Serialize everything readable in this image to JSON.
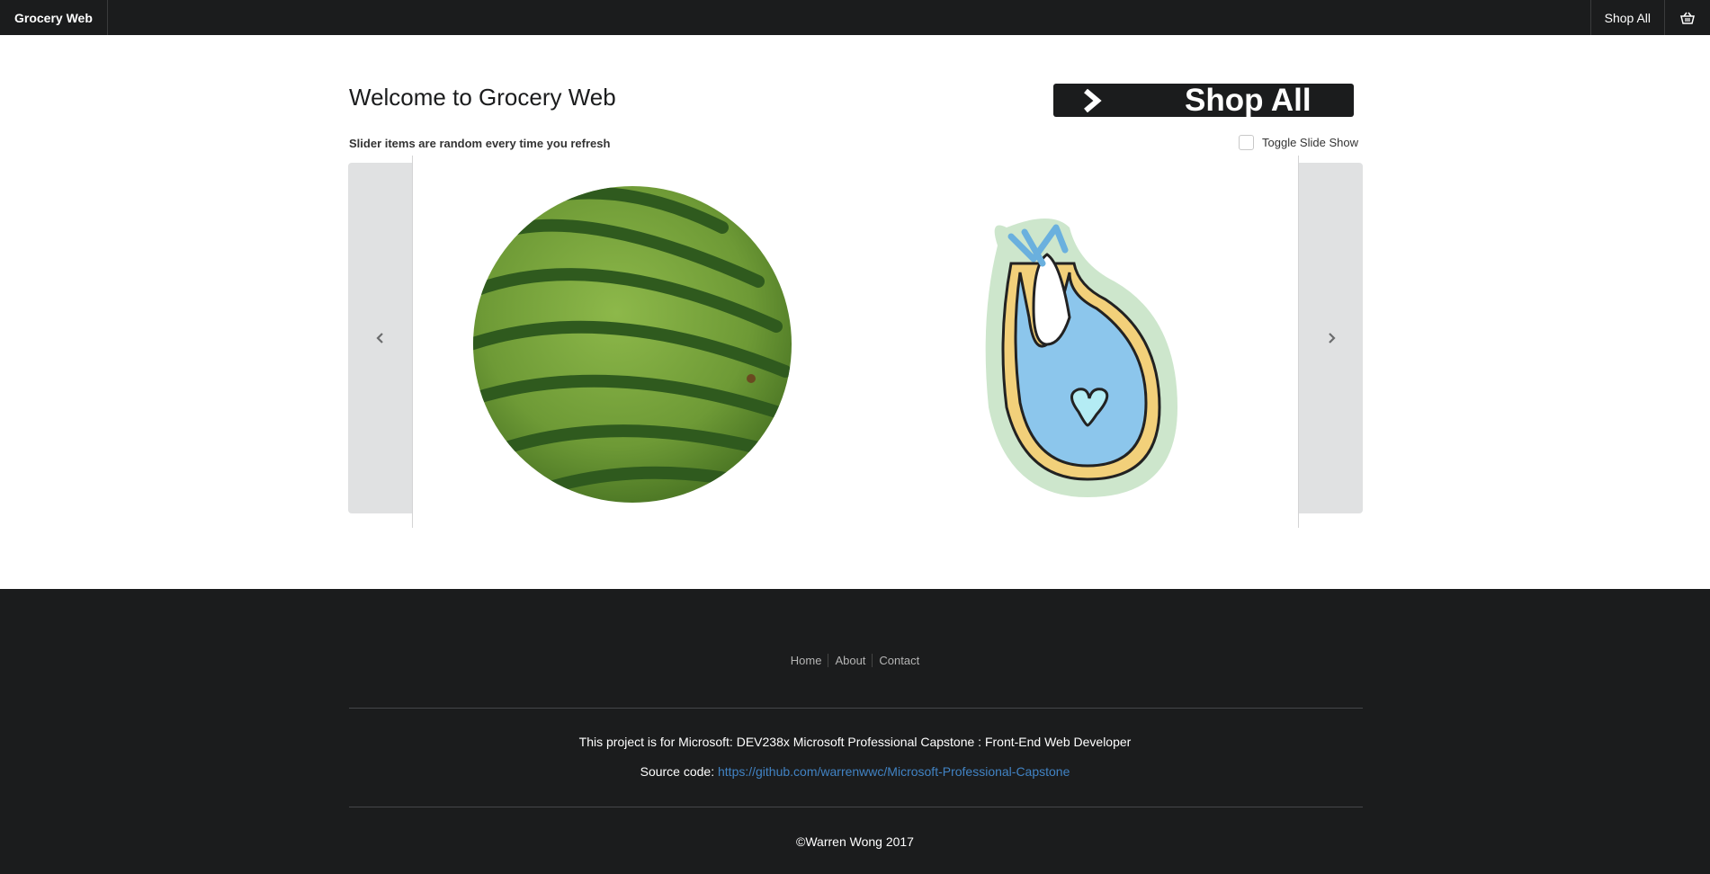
{
  "nav": {
    "brand": "Grocery Web",
    "shop_all": "Shop All",
    "cart_icon": "shopping-basket-icon"
  },
  "main": {
    "title": "Welcome to Grocery Web",
    "banner_label": "Shop All",
    "slider_note": "Slider items are random every time you refresh",
    "toggle_label": "Toggle Slide Show",
    "toggle_checked": false
  },
  "slider": {
    "prev_icon": "chevron-left-icon",
    "next_icon": "chevron-right-icon",
    "items": [
      {
        "name": "watermelon"
      },
      {
        "name": "bib"
      }
    ]
  },
  "footer": {
    "links": [
      "Home",
      "About",
      "Contact"
    ],
    "project_text": "This project is for Microsoft: DEV238x Microsoft Professional Capstone : Front-End Web Developer",
    "source_label": "Source code:",
    "source_url": "https://github.com/warrenwwc/Microsoft-Professional-Capstone",
    "copyright": "©Warren Wong 2017"
  },
  "colors": {
    "nav_bg": "#1b1c1d",
    "link": "#4183c4",
    "arrow_panel": "#e0e1e2"
  }
}
